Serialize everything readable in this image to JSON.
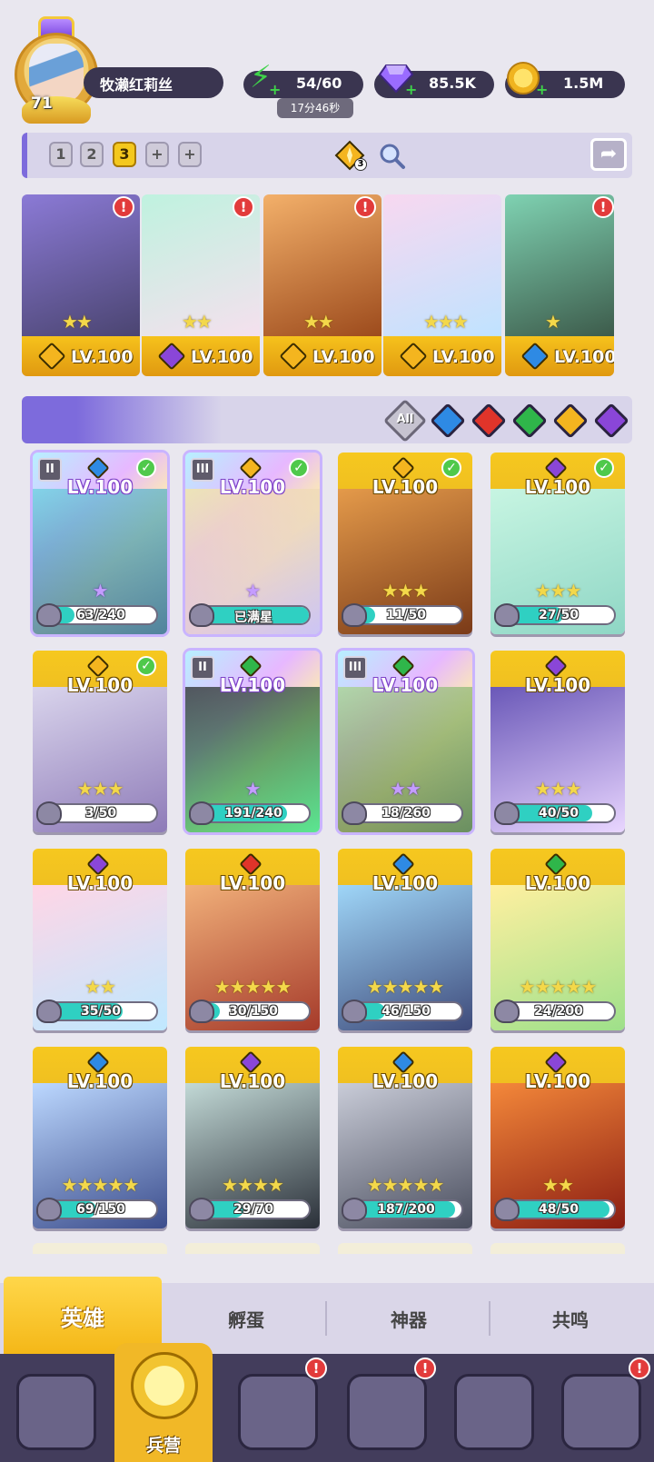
{
  "player": {
    "level": "71",
    "name": "牧濑红莉丝",
    "energy": "54/60",
    "energy_timer": "17分46秒",
    "gems": "85.5K",
    "coins": "1.5M"
  },
  "team": {
    "slots": [
      "1",
      "2",
      "3",
      "+",
      "+"
    ],
    "active_slot": "3",
    "power_badge": "3"
  },
  "team_heroes": [
    {
      "level": "LV.100",
      "element": "light",
      "stars": "★★",
      "alert": true
    },
    {
      "level": "LV.100",
      "element": "dark",
      "stars": "★★",
      "alert": true
    },
    {
      "level": "LV.100",
      "element": "light",
      "stars": "★★",
      "alert": true
    },
    {
      "level": "LV.100",
      "element": "light",
      "stars": "★★★",
      "alert": false
    },
    {
      "level": "LV.100",
      "element": "water",
      "stars": "★",
      "alert": true
    }
  ],
  "filters": {
    "all_label": "All",
    "elements": [
      "water",
      "fire",
      "wind",
      "light",
      "dark"
    ]
  },
  "heroes": [
    {
      "level": "LV.100",
      "element": "water",
      "progress": "63/240",
      "fill": 0.26,
      "holo": true,
      "check": true,
      "rank": "II",
      "stars": "★"
    },
    {
      "level": "LV.100",
      "element": "light",
      "progress": "已满星",
      "fill": 1.0,
      "holo": true,
      "check": true,
      "rank": "III",
      "stars": "★"
    },
    {
      "level": "LV.100",
      "element": "light",
      "progress": "11/50",
      "fill": 0.22,
      "holo": false,
      "check": true,
      "rank": "",
      "stars": "★★★"
    },
    {
      "level": "LV.100",
      "element": "dark",
      "progress": "27/50",
      "fill": 0.54,
      "holo": false,
      "check": true,
      "rank": "",
      "stars": "★★★"
    },
    {
      "level": "LV.100",
      "element": "light",
      "progress": "3/50",
      "fill": 0.06,
      "holo": false,
      "check": true,
      "rank": "",
      "stars": "★★★"
    },
    {
      "level": "LV.100",
      "element": "wind",
      "progress": "191/240",
      "fill": 0.8,
      "holo": true,
      "check": false,
      "rank": "II",
      "stars": "★"
    },
    {
      "level": "LV.100",
      "element": "wind",
      "progress": "18/260",
      "fill": 0.07,
      "holo": true,
      "check": false,
      "rank": "III",
      "stars": "★★"
    },
    {
      "level": "LV.100",
      "element": "dark",
      "progress": "40/50",
      "fill": 0.8,
      "holo": false,
      "check": false,
      "rank": "",
      "stars": "★★★"
    },
    {
      "level": "LV.100",
      "element": "dark",
      "progress": "35/50",
      "fill": 0.7,
      "holo": false,
      "check": false,
      "rank": "",
      "stars": "★★"
    },
    {
      "level": "LV.100",
      "element": "fire",
      "progress": "30/150",
      "fill": 0.2,
      "holo": false,
      "check": false,
      "rank": "",
      "stars": "★★★★★"
    },
    {
      "level": "LV.100",
      "element": "water",
      "progress": "46/150",
      "fill": 0.31,
      "holo": false,
      "check": false,
      "rank": "",
      "stars": "★★★★★"
    },
    {
      "level": "LV.100",
      "element": "wind",
      "progress": "24/200",
      "fill": 0.12,
      "holo": false,
      "check": false,
      "rank": "",
      "stars": "★★★★★"
    },
    {
      "level": "LV.100",
      "element": "water",
      "progress": "69/150",
      "fill": 0.46,
      "holo": false,
      "check": false,
      "rank": "",
      "stars": "★★★★★"
    },
    {
      "level": "LV.100",
      "element": "dark",
      "progress": "29/70",
      "fill": 0.41,
      "holo": false,
      "check": false,
      "rank": "",
      "stars": "★★★★"
    },
    {
      "level": "LV.100",
      "element": "water",
      "progress": "187/200",
      "fill": 0.94,
      "holo": false,
      "check": false,
      "rank": "",
      "stars": "★★★★★"
    },
    {
      "level": "LV.100",
      "element": "dark",
      "progress": "48/50",
      "fill": 0.96,
      "holo": false,
      "check": false,
      "rank": "",
      "stars": "★★"
    }
  ],
  "tabs": [
    "英雄",
    "孵蛋",
    "神器",
    "共鸣"
  ],
  "active_tab": "英雄",
  "nav": {
    "active_label": "兵营"
  },
  "colors": {
    "accent_gold": "#f4b717",
    "accent_purple": "#7d6bdc",
    "water": "#2e8ae4",
    "fire": "#e0342a",
    "wind": "#2fb64a",
    "light": "#f4b51f",
    "dark": "#8a46d8",
    "alert": "#e23b3b"
  }
}
